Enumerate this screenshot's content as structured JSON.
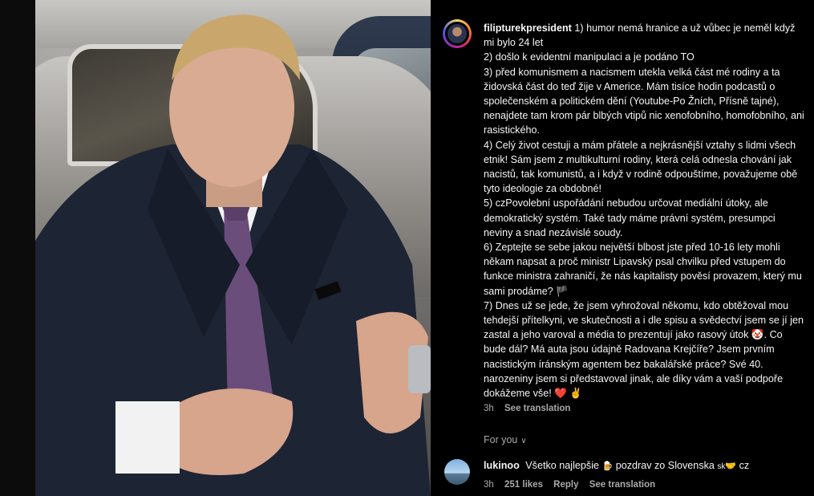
{
  "post": {
    "username": "filipturekpresident",
    "caption": "1) humor nemá hranice a už vůbec je neměl když mi bylo 24 let\n2) došlo k evidentní manipulaci a je podáno TO\n3) před komunismem a nacismem utekla velká část mé rodiny a ta židovská část do teď žije v Americe. Mám tisíce hodin podcastů o společenském a politickém dění (Youtube-Po Žních, Přísně tajné), nenajdete tam krom pár blbých vtipů nic xenofobního, homofobního, ani rasistického.\n4) Celý život cestuji a mám přátele a nejkrásnější vztahy s lidmi všech etnik! Sám jsem z multikulturní rodiny, která celá odnesla chování jak nacistů, tak komunistů, a i když v rodině odpouštíme, považujeme obě tyto ideologie za obdobné!\n5) czPovolební uspořádání nebudou určovat mediální útoky, ale demokratický systém. Také tady máme právní systém, presumpci neviny a snad nezávislé soudy.\n6) Zeptejte se sebe jakou největší blbost jste před 10-16 lety mohli někam napsat a proč ministr Lipavský psal chvilku před vstupem do funkce ministra zahraničí, že nás kapitalisty pověsí provazem, který mu sami prodáme? 🏴\n7) Dnes už se jede, že jsem vyhrožoval někomu, kdo obtěžoval mou tehdejší přítelkyni, ve skutečnosti a i dle spisu a svědectví jsem se jí jen zastal a jeho varoval a média to prezentují jako rasový útok 🤡. Co bude dál? Má auta jsou údajně Radovana Krejčíře? Jsem prvním nacistickým íránským agentem bez bakalářské práce? Své 40. narozeniny jsem si představoval jinak, ale díky vám a vaší podpoře dokážeme vše! ❤️ ✌️",
    "time": "3h",
    "see_translation": "See translation"
  },
  "for_you": {
    "label": "For you",
    "chevron": "∨"
  },
  "comment": {
    "username": "lukinoo",
    "text_before": "Všetko najlepšie",
    "emoji1": "🍺",
    "text_middle": "pozdrav zo Slovenska",
    "flag": "sk",
    "emoji2": "🤝",
    "text_after": "cz",
    "time": "3h",
    "likes": "251 likes",
    "reply": "Reply",
    "see_translation": "See translation"
  }
}
